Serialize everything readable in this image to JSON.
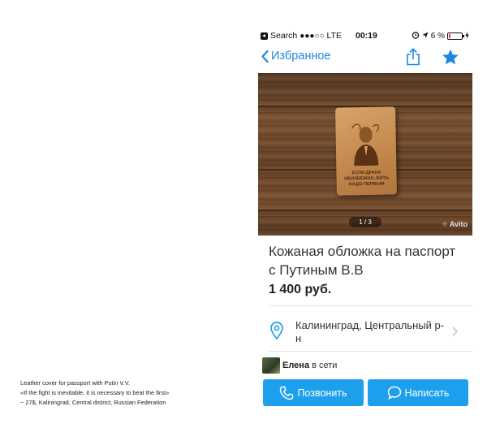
{
  "caption": {
    "line1": "Leather cover for passport with Putin V.V.",
    "line2": "«If the fight is inevitable, it is necessary to beat the first»",
    "line3": "~ 27$, Kaliningrad, Central district, Russian Federation"
  },
  "statusbar": {
    "app": "Search",
    "signal": "●●●○○",
    "network": "LTE",
    "time": "00:19",
    "battery": "6 %"
  },
  "nav": {
    "back_label": "Избранное",
    "accent_color": "#1a88e0"
  },
  "photo": {
    "counter": "1 / 3",
    "watermark": "Avito",
    "cover_text": "ЕСЛИ ДРАКА НЕИЗБЕЖНА, БИТЬ НАДО ПЕРВЫМ"
  },
  "listing": {
    "title": "Кожаная обложка на паспорт с Путиным В.В",
    "price": "1 400 руб.",
    "location": "Калининград, Центральный р-н"
  },
  "seller": {
    "name": "Елена",
    "status": "в сети"
  },
  "actions": {
    "call_label": "Позвонить",
    "write_label": "Написать",
    "button_color": "#1ca0ee"
  }
}
